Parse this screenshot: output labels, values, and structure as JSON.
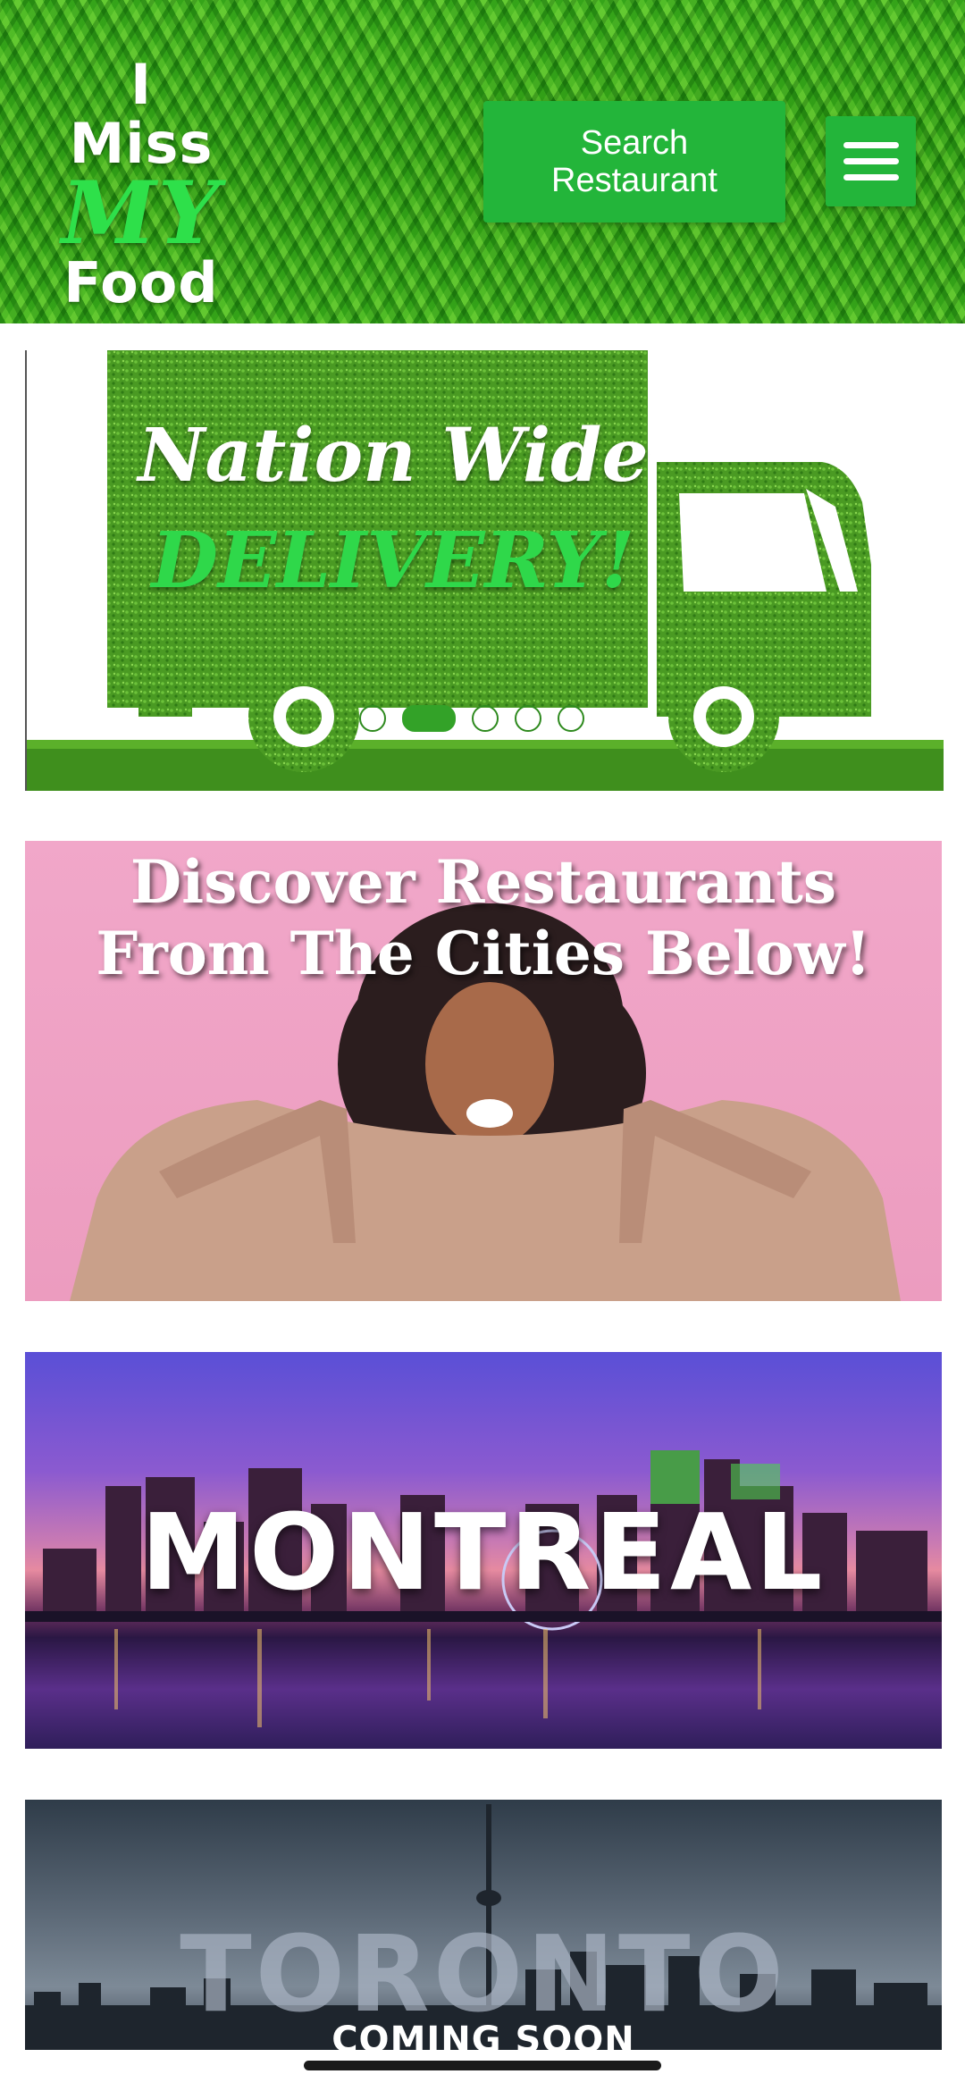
{
  "header": {
    "logo": {
      "line1": "I Miss",
      "line2": "MY",
      "line3": "Food"
    },
    "search_button": "Search\nRestaurant",
    "menu_icon": "hamburger-menu-icon"
  },
  "banners": {
    "delivery": {
      "title_line1": "Nation Wide",
      "title_line2": "DELIVERY!",
      "carousel": {
        "total": 5,
        "active_index": 1
      }
    },
    "discover": {
      "title": "Discover Restaurants\nFrom The Cities Below!"
    },
    "montreal": {
      "name": "MONTREAL"
    },
    "toronto": {
      "name": "TORONTO",
      "status": "COMING SOON"
    }
  },
  "colors": {
    "brand_green": "#23b53a",
    "logo_green": "#2ee04a",
    "delivery_green": "#2fd84a"
  }
}
